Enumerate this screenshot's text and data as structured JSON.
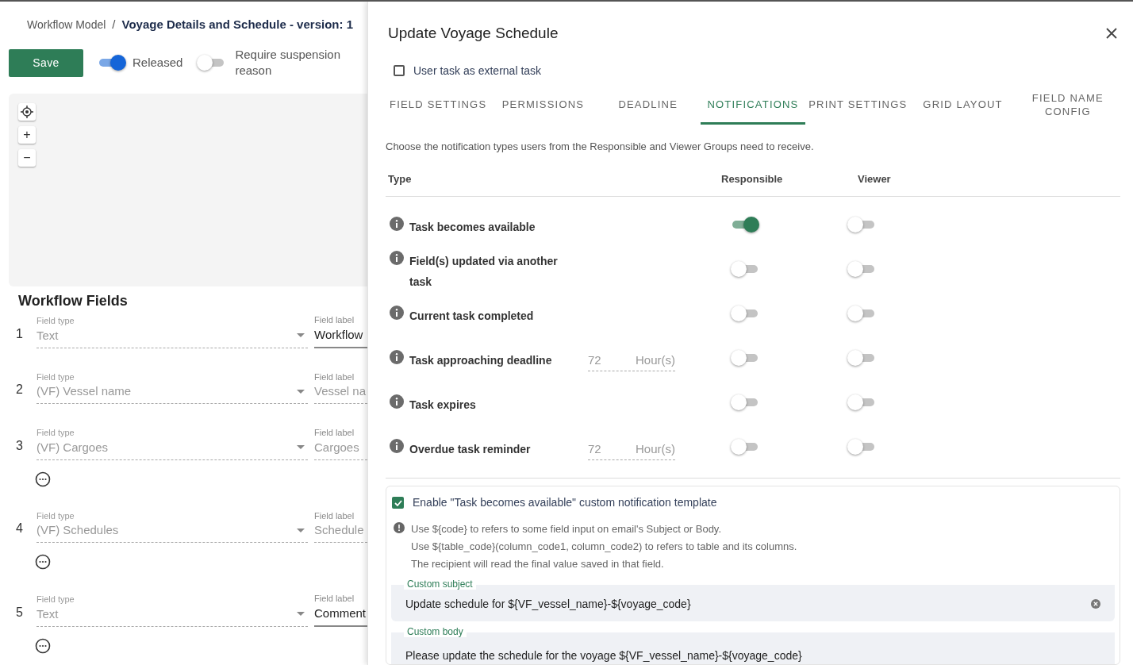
{
  "breadcrumb": {
    "parent": "Workflow Model",
    "separator": "/",
    "current": "Voyage Details and Schedule - version: 1"
  },
  "toolbar": {
    "save": "Save",
    "switches": [
      {
        "label": "Released",
        "on": true
      },
      {
        "label": "Require suspension reason",
        "on": false
      }
    ]
  },
  "canvas_controls": {
    "zoom_in": "+",
    "zoom_out": "−"
  },
  "workflow_fields": {
    "title": "Workflow Fields",
    "rows": [
      {
        "number": "1",
        "type_label": "Field type",
        "type_value": "Text",
        "label_label": "Field label",
        "label_value": "Workflow",
        "label_disabled": false,
        "has_menu": false
      },
      {
        "number": "2",
        "type_label": "Field type",
        "type_value": "(VF) Vessel name",
        "label_label": "Field label",
        "label_value": "Vessel na",
        "label_disabled": true,
        "has_menu": false
      },
      {
        "number": "3",
        "type_label": "Field type",
        "type_value": "(VF) Cargoes",
        "label_label": "Field label",
        "label_value": "Cargoes",
        "label_disabled": true,
        "has_menu": true
      },
      {
        "number": "4",
        "type_label": "Field type",
        "type_value": "(VF) Schedules",
        "label_label": "Field label",
        "label_value": "Schedule",
        "label_disabled": true,
        "has_menu": true
      },
      {
        "number": "5",
        "type_label": "Field type",
        "type_value": "Text",
        "label_label": "Field label",
        "label_value": "Comment",
        "label_disabled": false,
        "has_menu": true
      }
    ]
  },
  "drawer": {
    "title": "Update Voyage Schedule",
    "external_task": {
      "label": "User task as external task",
      "checked": false
    },
    "tabs": [
      {
        "label": "FIELD SETTINGS",
        "selected": false
      },
      {
        "label": "PERMISSIONS",
        "selected": false
      },
      {
        "label": "DEADLINE",
        "selected": false
      },
      {
        "label": "NOTIFICATIONS",
        "selected": true
      },
      {
        "label": "PRINT SETTINGS",
        "selected": false
      },
      {
        "label": "GRID LAYOUT",
        "selected": false
      },
      {
        "label": "FIELD NAME CONFIG",
        "selected": false
      }
    ],
    "description": "Choose the notification types users from the Responsible and Viewer Groups need to receive.",
    "columns": [
      "Type",
      "Responsible",
      "Viewer"
    ],
    "rows": [
      {
        "kind": "plain",
        "type": "Task becomes available",
        "responsible": true,
        "viewer": false
      },
      {
        "kind": "plain",
        "type": "Field(s) updated via another task",
        "responsible": false,
        "viewer": false
      },
      {
        "kind": "plain",
        "type": "Current task completed",
        "responsible": false,
        "viewer": false
      },
      {
        "kind": "hours",
        "type": "Task approaching deadline",
        "hours": "72",
        "unit": "Hour(s)",
        "responsible": false,
        "viewer": false
      },
      {
        "kind": "plain",
        "type": "Task expires",
        "responsible": false,
        "viewer": false
      },
      {
        "kind": "hours",
        "type": "Overdue task reminder",
        "hours": "72",
        "unit": "Hour(s)",
        "responsible": false,
        "viewer": false
      }
    ],
    "template": {
      "enable": {
        "label": "Enable \"Task becomes available\" custom notification template",
        "checked": true
      },
      "hints": [
        "Use ${code} to refers to some field input on email's Subject or Body.",
        "Use ${table_code}(column_code1, column_code2) to refers to table and its columns.",
        "The recipient will read the final value saved in that field."
      ],
      "subject": {
        "label": "Custom subject",
        "value": "Update schedule for ${VF_vessel_name}-${voyage_code}"
      },
      "body": {
        "label": "Custom body",
        "value": "Please update the schedule for the voyage ${VF_vessel_name}-${voyage_code}"
      }
    }
  }
}
